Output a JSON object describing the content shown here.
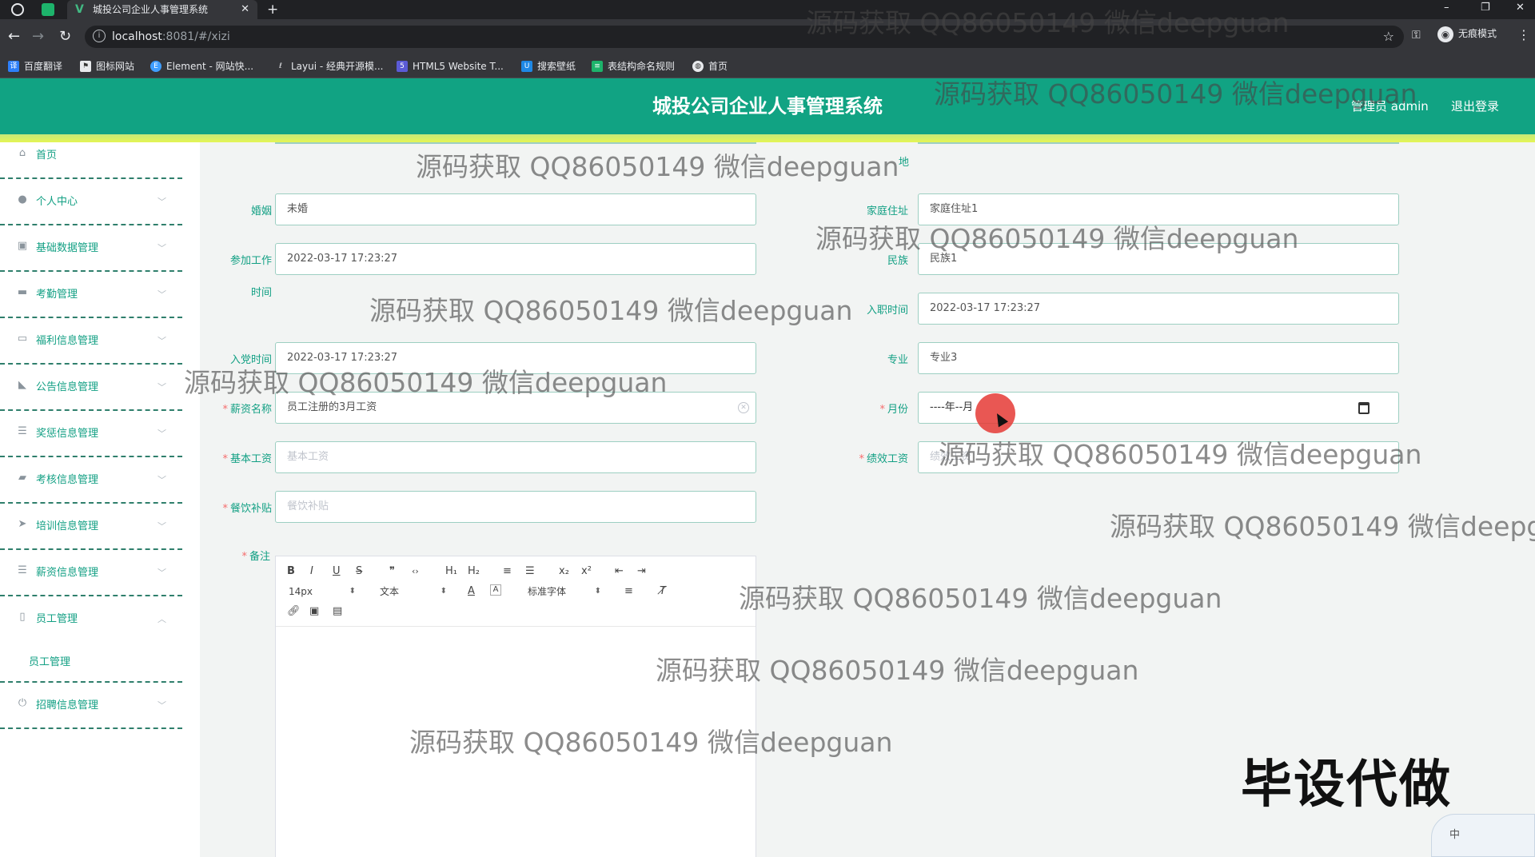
{
  "browser": {
    "tab_title": "城投公司企业人事管理系统",
    "tab_close": "✕",
    "new_tab": "+",
    "url_host": "localhost",
    "url_path": ":8081/#/xizi",
    "incognito_label": "无痕模式",
    "bookmarks": [
      "百度翻译",
      "图标网站",
      "Element - 网站快...",
      "Layui - 经典开源模...",
      "HTML5 Website T...",
      "搜索壁纸",
      "表结构命名规则",
      "首页"
    ]
  },
  "header": {
    "title": "城投公司企业人事管理系统",
    "admin_label": "管理员 admin",
    "logout_label": "退出登录"
  },
  "sidebar": {
    "items": [
      {
        "label": "首页",
        "icon": "home-icon"
      },
      {
        "label": "个人中心",
        "icon": "user-icon"
      },
      {
        "label": "基础数据管理",
        "icon": "data-icon"
      },
      {
        "label": "考勤管理",
        "icon": "attendance-icon"
      },
      {
        "label": "福利信息管理",
        "icon": "welfare-icon"
      },
      {
        "label": "公告信息管理",
        "icon": "notice-icon"
      },
      {
        "label": "奖惩信息管理",
        "icon": "reward-icon"
      },
      {
        "label": "考核信息管理",
        "icon": "assessment-icon"
      },
      {
        "label": "培训信息管理",
        "icon": "training-icon"
      },
      {
        "label": "薪资信息管理",
        "icon": "salary-icon"
      },
      {
        "label": "员工管理",
        "icon": "employee-icon"
      },
      {
        "label": "招聘信息管理",
        "icon": "recruit-icon"
      }
    ],
    "sub_item": "员工管理"
  },
  "form": {
    "addr_label_tail": "地",
    "marriage_label": "婚姻",
    "marriage_value": "未婚",
    "home_label": "家庭住址",
    "home_value": "家庭住址1",
    "work_label_1": "参加工作",
    "work_label_2": "时间",
    "work_value": "2022-03-17 17:23:27",
    "ethnic_label": "民族",
    "ethnic_value": "民族1",
    "hire_label": "入职时间",
    "hire_value": "2022-03-17 17:23:27",
    "party_label": "入党时间",
    "party_value": "2022-03-17 17:23:27",
    "major_label": "专业",
    "major_value": "专业3",
    "salary_name_label": "薪资名称",
    "salary_name_value": "员工注册的3月工资",
    "month_label": "月份",
    "month_value": "----年--月",
    "base_salary_label": "基本工资",
    "base_salary_placeholder": "基本工资",
    "perf_label": "绩效工资",
    "perf_placeholder": "绩效工资",
    "meal_label": "餐饮补贴",
    "meal_placeholder": "餐饮补贴",
    "remark_label": "备注",
    "required_mark": "*"
  },
  "editor": {
    "font_size": "14px",
    "heading": "文本",
    "font_family": "标准字体",
    "tools": [
      "B",
      "I",
      "U",
      "S",
      "❞",
      "‹›",
      "H₁",
      "H₂",
      "≡",
      "☰",
      "x₂",
      "x²",
      "⇤",
      "⇥"
    ]
  },
  "watermark": "源码获取 QQ86050149 微信deepguan",
  "big_watermark": "毕设代做",
  "corner_widget": "中"
}
